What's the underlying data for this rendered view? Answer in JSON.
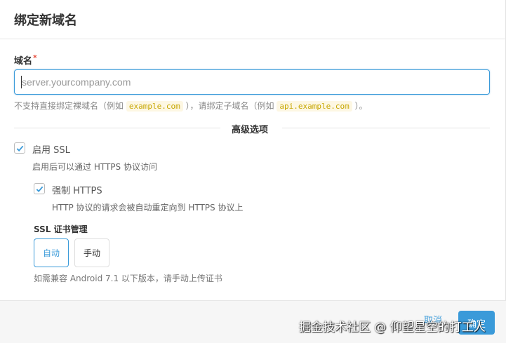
{
  "dialog": {
    "title": "绑定新域名"
  },
  "domain_field": {
    "label": "域名",
    "required_mark": "*",
    "value": "",
    "placeholder": "server.yourcompany.com",
    "help_prefix": "不支持直接绑定裸域名（例如",
    "help_example_1": "example.com",
    "help_middle": "），请绑定子域名（例如",
    "help_example_2": "api.example.com",
    "help_suffix": "）。"
  },
  "advanced": {
    "divider_label": "高级选项",
    "ssl": {
      "label": "启用 SSL",
      "checked": true,
      "description": "启用后可以通过 HTTPS 协议访问"
    },
    "force_https": {
      "label": "强制 HTTPS",
      "checked": true,
      "description": "HTTP 协议的请求会被自动重定向到 HTTPS 协议上"
    },
    "cert_management": {
      "title": "SSL 证书管理",
      "options": [
        "自动",
        "手动"
      ],
      "selected": "自动",
      "note": "如需兼容 Android 7.1 以下版本，请手动上传证书"
    }
  },
  "footer": {
    "cancel_label": "取消",
    "confirm_label": "确定"
  },
  "watermark": "掘金技术社区 @ 仰望星空的打工人",
  "colors": {
    "accent": "#3a9ad9",
    "required": "#e74c3c",
    "code_text": "#c7a600"
  }
}
